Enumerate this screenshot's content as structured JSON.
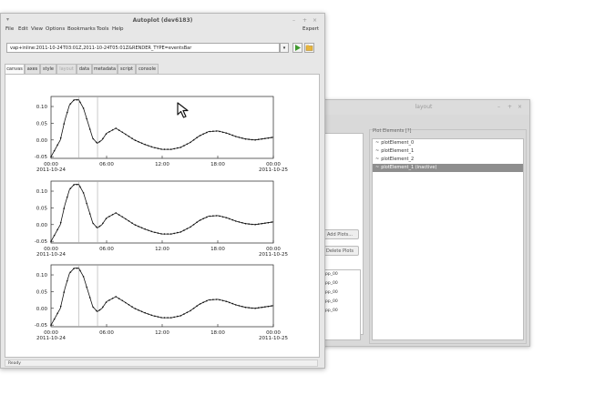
{
  "layout_window": {
    "title": "layout",
    "buttons": {
      "add_plots": "Add Plots...",
      "delete_plots": "Delete Plots"
    },
    "left_list": [
      "pp_00",
      "pp_00",
      "pp_00",
      "pp_00",
      "pp_00"
    ],
    "plot_elements_label": "Plot Elements [?]",
    "plot_elements": [
      {
        "label": "plotElement_0",
        "selected": false
      },
      {
        "label": "plotElement_1",
        "selected": false
      },
      {
        "label": "plotElement_2",
        "selected": false
      },
      {
        "label": "plotElement_1 (inactive)",
        "selected": true
      }
    ]
  },
  "autoplot": {
    "title": "Autoplot (dev6183)",
    "menu": [
      "File",
      "Edit",
      "View",
      "Options",
      "Bookmarks",
      "Tools",
      "Help"
    ],
    "expert": "Expert",
    "uri": "vap+inline:2011-10-24T03:01Z,2011-10-24T05:01Z&RENDER_TYPE=eventsBar",
    "tabs": [
      {
        "label": "canvas",
        "state": "active"
      },
      {
        "label": "axes",
        "state": "normal"
      },
      {
        "label": "style",
        "state": "normal"
      },
      {
        "label": "layout",
        "state": "disabled"
      },
      {
        "label": "data",
        "state": "normal"
      },
      {
        "label": "metadata",
        "state": "normal"
      },
      {
        "label": "script",
        "state": "normal"
      },
      {
        "label": "console",
        "state": "normal"
      }
    ],
    "status": "Ready"
  },
  "chart_data": [
    {
      "type": "line",
      "title": "",
      "x_ticks": [
        "00:00",
        "06:00",
        "12:00",
        "18:00",
        "00:00"
      ],
      "x_date_labels": [
        "2011-10-24",
        "",
        "",
        "",
        "2011-10-25"
      ],
      "y_ticks": [
        "0.10",
        "0.05",
        "0.00",
        "-0.05"
      ],
      "ylim": [
        -0.055,
        0.13
      ],
      "xlim_hours": [
        0,
        24
      ],
      "x_hours": [
        0,
        1,
        1.5,
        2,
        2.5,
        3,
        3.5,
        4,
        4.5,
        5,
        5.5,
        6,
        7,
        8,
        9,
        10,
        11,
        12,
        13,
        14,
        15,
        16,
        17,
        18,
        19,
        20,
        21,
        22,
        23,
        24
      ],
      "values": [
        -0.05,
        0.0,
        0.06,
        0.105,
        0.12,
        0.12,
        0.095,
        0.05,
        0.005,
        -0.01,
        0.0,
        0.02,
        0.035,
        0.018,
        0.0,
        -0.012,
        -0.022,
        -0.028,
        -0.028,
        -0.022,
        -0.008,
        0.012,
        0.025,
        0.027,
        0.02,
        0.01,
        0.003,
        0.0,
        0.004,
        0.008
      ],
      "marker": true
    },
    {
      "type": "line",
      "title": "",
      "x_ticks": [
        "00:00",
        "06:00",
        "12:00",
        "18:00",
        "00:00"
      ],
      "x_date_labels": [
        "2011-10-24",
        "",
        "",
        "",
        "2011-10-25"
      ],
      "y_ticks": [
        "0.10",
        "0.05",
        "0.00",
        "-0.05"
      ],
      "ylim": [
        -0.055,
        0.13
      ],
      "xlim_hours": [
        0,
        24
      ],
      "x_hours": [
        0,
        1,
        1.5,
        2,
        2.5,
        3,
        3.5,
        4,
        4.5,
        5,
        5.5,
        6,
        7,
        8,
        9,
        10,
        11,
        12,
        13,
        14,
        15,
        16,
        17,
        18,
        19,
        20,
        21,
        22,
        23,
        24
      ],
      "values": [
        -0.05,
        0.0,
        0.06,
        0.105,
        0.12,
        0.12,
        0.095,
        0.05,
        0.005,
        -0.01,
        0.0,
        0.02,
        0.035,
        0.018,
        0.0,
        -0.012,
        -0.022,
        -0.028,
        -0.028,
        -0.022,
        -0.008,
        0.012,
        0.025,
        0.027,
        0.02,
        0.01,
        0.003,
        0.0,
        0.004,
        0.008
      ],
      "marker": true
    },
    {
      "type": "line",
      "title": "",
      "x_ticks": [
        "00:00",
        "06:00",
        "12:00",
        "18:00",
        "00:00"
      ],
      "x_date_labels": [
        "2011-10-24",
        "",
        "",
        "",
        "2011-10-25"
      ],
      "y_ticks": [
        "0.10",
        "0.05",
        "0.00",
        "-0.05"
      ],
      "ylim": [
        -0.055,
        0.13
      ],
      "xlim_hours": [
        0,
        24
      ],
      "x_hours": [
        0,
        1,
        1.5,
        2,
        2.5,
        3,
        3.5,
        4,
        4.5,
        5,
        5.5,
        6,
        7,
        8,
        9,
        10,
        11,
        12,
        13,
        14,
        15,
        16,
        17,
        18,
        19,
        20,
        21,
        22,
        23,
        24
      ],
      "values": [
        -0.05,
        0.0,
        0.06,
        0.105,
        0.12,
        0.12,
        0.095,
        0.05,
        0.005,
        -0.01,
        0.0,
        0.02,
        0.035,
        0.018,
        0.0,
        -0.012,
        -0.022,
        -0.028,
        -0.028,
        -0.022,
        -0.008,
        0.012,
        0.025,
        0.027,
        0.02,
        0.01,
        0.003,
        0.0,
        0.004,
        0.008
      ],
      "marker": true
    }
  ],
  "event_bar": {
    "start_hour": 3.02,
    "end_hour": 5.02
  }
}
